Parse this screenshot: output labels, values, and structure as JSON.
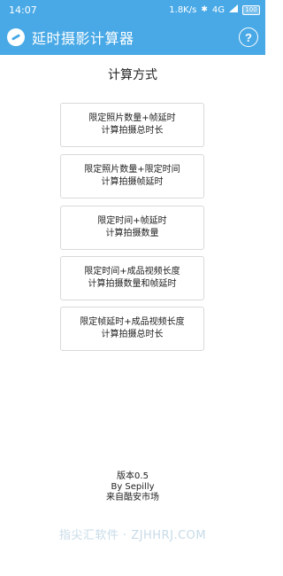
{
  "status_bar": {
    "time": "14:07",
    "network_speed": "1.8K/s",
    "bluetooth_icon": "bluetooth-icon",
    "network": "4G",
    "battery": "100"
  },
  "app_bar": {
    "title": "延时摄影计算器",
    "help_label": "?"
  },
  "section_title": "计算方式",
  "modes": [
    {
      "line1": "限定照片数量+帧延时",
      "line2": "计算拍摄总时长"
    },
    {
      "line1": "限定照片数量+限定时间",
      "line2": "计算拍摄帧延时"
    },
    {
      "line1": "限定时间+帧延时",
      "line2": "计算拍摄数量"
    },
    {
      "line1": "限定时间+成品视频长度",
      "line2": "计算拍摄数量和帧延时"
    },
    {
      "line1": "限定帧延时+成品视频长度",
      "line2": "计算拍摄总时长"
    }
  ],
  "footer": {
    "version": "版本0.5",
    "author": "By Sepilly",
    "source": "来自酷安市场"
  },
  "watermark": "指尖汇软件 · ZJHHRJ.COM",
  "colors": {
    "accent": "#49a9e6"
  }
}
